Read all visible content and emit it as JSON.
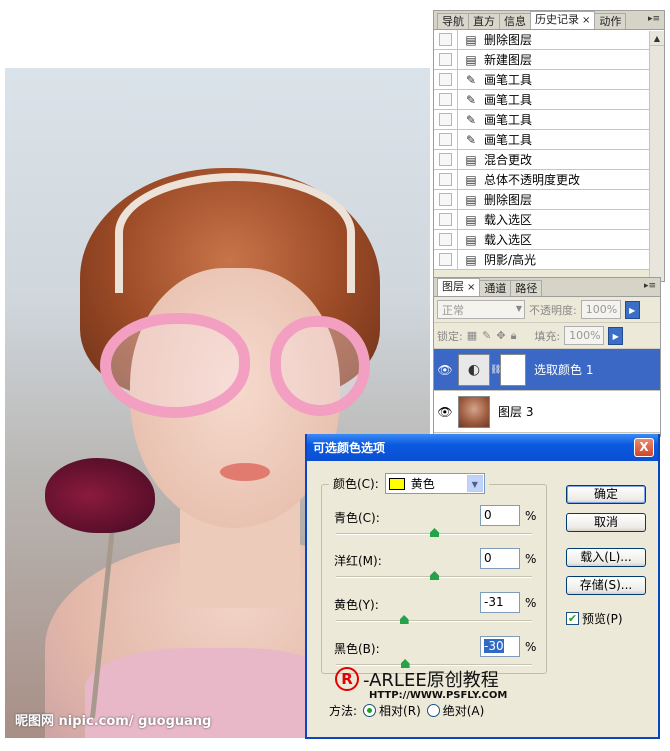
{
  "photo": {
    "watermark": "昵图网 nipic.com/ guoguang"
  },
  "history_panel": {
    "tabs": [
      "导航",
      "直方",
      "信息",
      "历史记录",
      "动作"
    ],
    "active_tab": "历史记录",
    "close_glyph": "×",
    "items": [
      {
        "label": "删除图层",
        "icon": "document-icon"
      },
      {
        "label": "新建图层",
        "icon": "document-icon"
      },
      {
        "label": "画笔工具",
        "icon": "brush-icon"
      },
      {
        "label": "画笔工具",
        "icon": "brush-icon"
      },
      {
        "label": "画笔工具",
        "icon": "brush-icon"
      },
      {
        "label": "画笔工具",
        "icon": "brush-icon"
      },
      {
        "label": "混合更改",
        "icon": "document-icon"
      },
      {
        "label": "总体不透明度更改",
        "icon": "document-icon"
      },
      {
        "label": "删除图层",
        "icon": "document-icon"
      },
      {
        "label": "载入选区",
        "icon": "document-icon"
      },
      {
        "label": "载入选区",
        "icon": "document-icon"
      },
      {
        "label": "阴影/高光",
        "icon": "document-icon"
      }
    ]
  },
  "layers_panel": {
    "tabs": [
      "图层",
      "通道",
      "路径"
    ],
    "active_tab": "图层",
    "close_glyph": "×",
    "blend_mode": "正常",
    "opacity_label": "不透明度:",
    "opacity_value": "100%",
    "lock_label": "锁定:",
    "fill_label": "填充:",
    "fill_value": "100%",
    "layers": [
      {
        "name": "选取颜色 1",
        "selected": true
      },
      {
        "name": "图层 3",
        "selected": false
      }
    ]
  },
  "dialog": {
    "title": "可选颜色选项",
    "close_glyph": "X",
    "colors_label": "颜色(C):",
    "colors_value": "黄色",
    "swatch_color": "#ffff00",
    "sliders": [
      {
        "label": "青色(C):",
        "value": "0",
        "unit": "%",
        "level": 0
      },
      {
        "label": "洋红(M):",
        "value": "0",
        "unit": "%",
        "level": 0
      },
      {
        "label": "黄色(Y):",
        "value": "-31",
        "unit": "%",
        "level": -31
      },
      {
        "label": "黑色(B):",
        "value": "-30",
        "unit": "%",
        "level": -30
      }
    ],
    "buttons": {
      "ok": "确定",
      "cancel": "取消",
      "load": "载入(L)...",
      "save": "存储(S)..."
    },
    "preview_label": "预览(P)",
    "preview_checked": true,
    "method_label": "方法:",
    "method_relative": "相对(R)",
    "method_absolute": "绝对(A)",
    "method_selected": "relative",
    "logo_symbol": "R",
    "logo_text": "-ARLEE原创教程",
    "logo_url": "HTTP://WWW.PSFLY.COM"
  }
}
